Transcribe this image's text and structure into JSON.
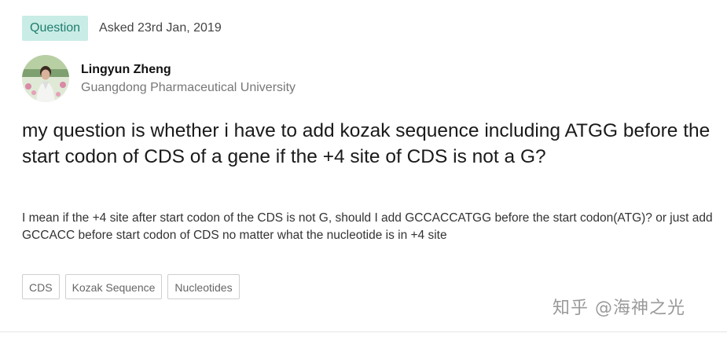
{
  "header": {
    "badge": "Question",
    "asked": "Asked 23rd Jan, 2019"
  },
  "author": {
    "name": "Lingyun Zheng",
    "institution": "Guangdong Pharmaceutical University"
  },
  "question": {
    "title": "my question is whether i have to add kozak sequence including ATGG before the start codon of CDS of a gene if the +4 site of CDS is not a G?",
    "body": "I mean if the +4 site after start codon of the CDS is not G, should I add GCCACCATGG before the start codon(ATG)? or just add GCCACC before start codon of CDS no matter what the nucleotide is in +4 site"
  },
  "tags": [
    "CDS",
    "Kozak Sequence",
    "Nucleotides"
  ],
  "watermark": "知乎 @海神之光"
}
